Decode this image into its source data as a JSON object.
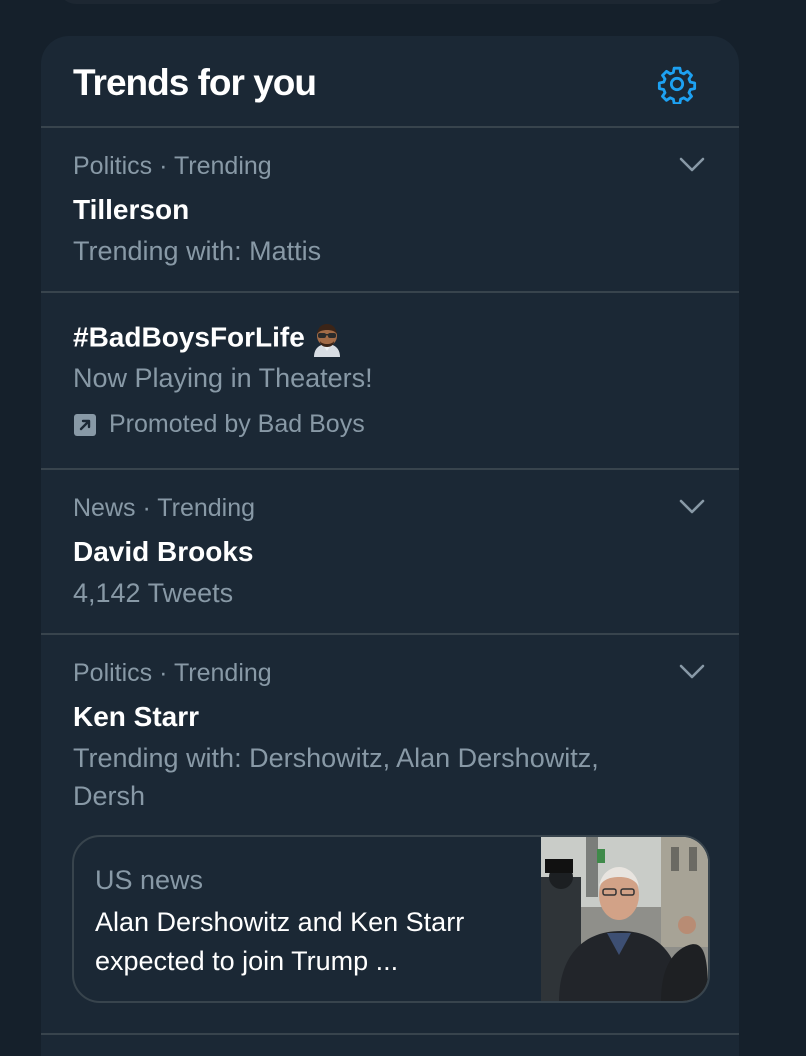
{
  "panel": {
    "title": "Trends for you",
    "settings_icon": "gear-icon"
  },
  "trends": [
    {
      "meta": "Politics · Trending",
      "name": "Tillerson",
      "sub": "Trending with: Mattis"
    },
    {
      "name": "#BadBoysForLife",
      "emoji_icon": "sunglasses-man-emoji-icon",
      "sub": "Now Playing in Theaters!",
      "promoted": "Promoted by Bad Boys"
    },
    {
      "meta": "News · Trending",
      "name": "David Brooks",
      "sub": "4,142 Tweets"
    },
    {
      "meta": "Politics · Trending",
      "name": "Ken Starr",
      "sub_line1": "Trending with: Dershowitz, Alan Dershowitz,",
      "sub_line2": "Dersh",
      "card": {
        "source": "US news",
        "headline_line1": "Alan Dershowitz and Ken Starr",
        "headline_line2": "expected to join Trump ..."
      }
    }
  ],
  "colors": {
    "background": "#15202b",
    "panel": "#1b2835",
    "divider": "#38444d",
    "secondary_text": "#8899a6",
    "accent": "#1da1f2"
  }
}
